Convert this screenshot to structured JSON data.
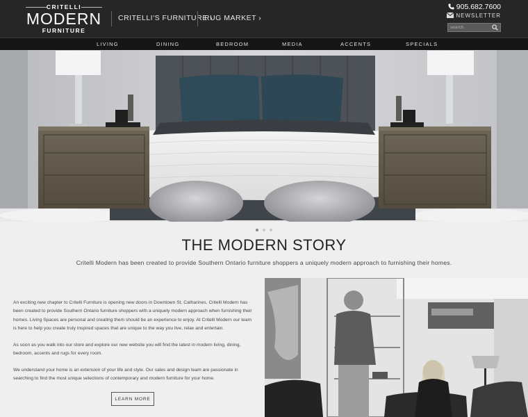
{
  "header": {
    "logo": {
      "top": "CRITELLI",
      "middle": "MODERN",
      "bottom": "FURNITURE"
    },
    "links": [
      {
        "label": "CRITELLI'S FURNITURE ›"
      },
      {
        "label": "RUG MARKET ›"
      }
    ],
    "phone": "905.682.7600",
    "newsletter": "NEWSLETTER",
    "search_placeholder": "search"
  },
  "nav": {
    "items": [
      {
        "label": "LIVING"
      },
      {
        "label": "DINING"
      },
      {
        "label": "BEDROOM"
      },
      {
        "label": "MEDIA"
      },
      {
        "label": "ACCENTS"
      },
      {
        "label": "SPECIALS"
      }
    ]
  },
  "hero": {
    "slide_count": 3,
    "active_slide": 1
  },
  "story": {
    "title": "THE MODERN STORY",
    "subtitle": "Critelli Modern has been created to provide Southern Ontario furniture shoppers a uniquely modern approach to furnishing their homes.",
    "paragraphs": [
      "An exciting new chapter to Critelli Furniture is opening new doors in Downtown St. Catharines. Critelli Modern has been created to provide Southern Ontario furniture shoppers with a uniquely modern approach when furnishing their homes. Living Spaces are personal and creating them should be an experience to enjoy. At Critelli Modern our team is here to help you create truly inspired spaces that are unique to the way you live, relax and entertain.",
      "As soon as you walk into our store and explore our new website you will find the latest in modern living, dining, bedroom, accents and rugs for every room.",
      "We understand your home is an extension of your life and style. Our sales and design team are passionate in searching to find the most unique selections of contemporary and modern furniture for your home."
    ],
    "button_label": "LEARN MORE"
  },
  "icons": {
    "phone": "phone-icon",
    "newsletter": "envelope-icon",
    "search": "search-icon"
  },
  "colors": {
    "header_bg": "#262626",
    "nav_bg": "#151515",
    "page_bg": "#efefef"
  }
}
